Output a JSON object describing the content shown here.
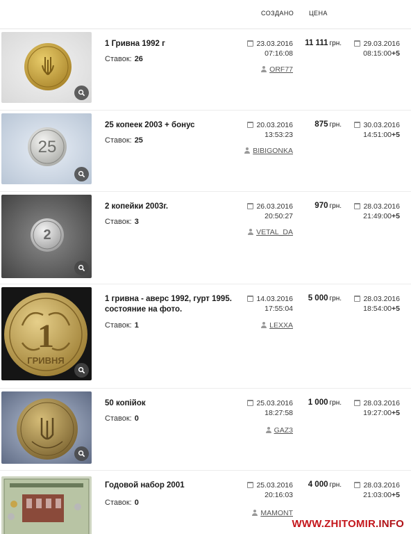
{
  "header": {
    "created_label": "СОЗДАНО",
    "price_label": "ЦЕНА"
  },
  "lots": [
    {
      "title": "1 Гривна 1992 г",
      "bids_label": "Ставок:",
      "bids": "26",
      "created_date": "23.03.2016",
      "created_time": "07:16:08",
      "user": "ORF77",
      "price": "11 111",
      "currency": "грн.",
      "end_date": "29.03.2016",
      "end_time": "08:15:00",
      "tz": "+5",
      "coin": "1 hryvnia 1992 gold coin"
    },
    {
      "title": "25 копеек 2003 + бонус",
      "bids_label": "Ставок:",
      "bids": "25",
      "created_date": "20.03.2016",
      "created_time": "13:53:23",
      "user": "BIBIGONKA",
      "price": "875",
      "currency": "грн.",
      "end_date": "30.03.2016",
      "end_time": "14:51:00",
      "tz": "+5",
      "coin": "25 kopiyok silver coin"
    },
    {
      "title": "2 копейки 2003г.",
      "bids_label": "Ставок:",
      "bids": "3",
      "created_date": "26.03.2016",
      "created_time": "20:50:27",
      "user": "VETAL_DA",
      "price": "970",
      "currency": "грн.",
      "end_date": "28.03.2016",
      "end_time": "21:49:00",
      "tz": "+5",
      "coin": "2 kopiyky coin"
    },
    {
      "title": "1 гривна - аверс 1992, гурт 1995. состояние на фото.",
      "bids_label": "Ставок:",
      "bids": "1",
      "created_date": "14.03.2016",
      "created_time": "17:55:04",
      "user": "LEXXA",
      "price": "5 000",
      "currency": "грн.",
      "end_date": "28.03.2016",
      "end_time": "18:54:00",
      "tz": "+5",
      "coin": "1 hryvnia reverse"
    },
    {
      "title": "50 копійок",
      "bids_label": "Ставок:",
      "bids": "0",
      "created_date": "25.03.2016",
      "created_time": "18:27:58",
      "user": "GAZ3",
      "price": "1 000",
      "currency": "грн.",
      "end_date": "28.03.2016",
      "end_time": "19:27:00",
      "tz": "+5",
      "coin": "50 kopiyok coin"
    },
    {
      "title": "Годовой набор 2001",
      "bids_label": "Ставок:",
      "bids": "0",
      "created_date": "25.03.2016",
      "created_time": "20:16:03",
      "user": "MAMONT",
      "price": "4 000",
      "currency": "грн.",
      "end_date": "28.03.2016",
      "end_time": "21:03:00",
      "tz": "+5",
      "coin": "coin set booklet"
    }
  ],
  "watermark": {
    "prefix": "WWW.",
    "name": "ZHITOMIR",
    "suffix": ".INFO"
  },
  "colors": {
    "watermark": "#c4161c",
    "gold": "#c9a640",
    "silver": "#cfd3d8"
  }
}
